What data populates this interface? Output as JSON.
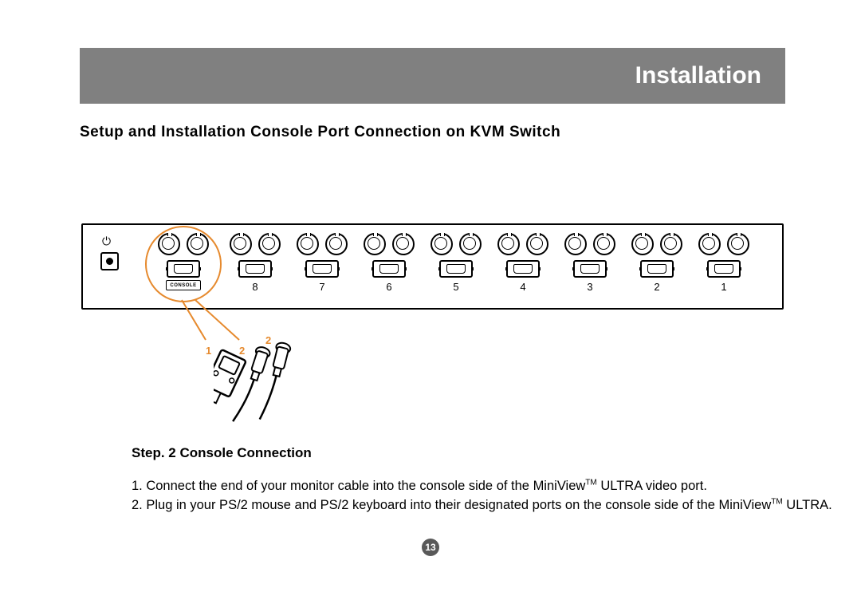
{
  "header": {
    "title": "Installation"
  },
  "subheading": "Setup and Installation Console Port Connection on KVM Switch",
  "device": {
    "console_label": "CONSOLE",
    "port_numbers": [
      "8",
      "7",
      "6",
      "5",
      "4",
      "3",
      "2",
      "1"
    ]
  },
  "callouts": {
    "label1": "1",
    "label2": "2"
  },
  "step": {
    "prefix": "Step. 2 ",
    "title": "Console Connection"
  },
  "instructions": {
    "line1_pre": "1. Connect the end of your monitor cable into the console side of the MiniView",
    "line1_tm": "TM",
    "line1_post": " ULTRA video port.",
    "line2_pre": "2. Plug in your PS/2 mouse and PS/2 keyboard into their designated ports on the console side of the MiniView",
    "line2_tm": "TM",
    "line2_post": " ULTRA."
  },
  "page_number": "13"
}
